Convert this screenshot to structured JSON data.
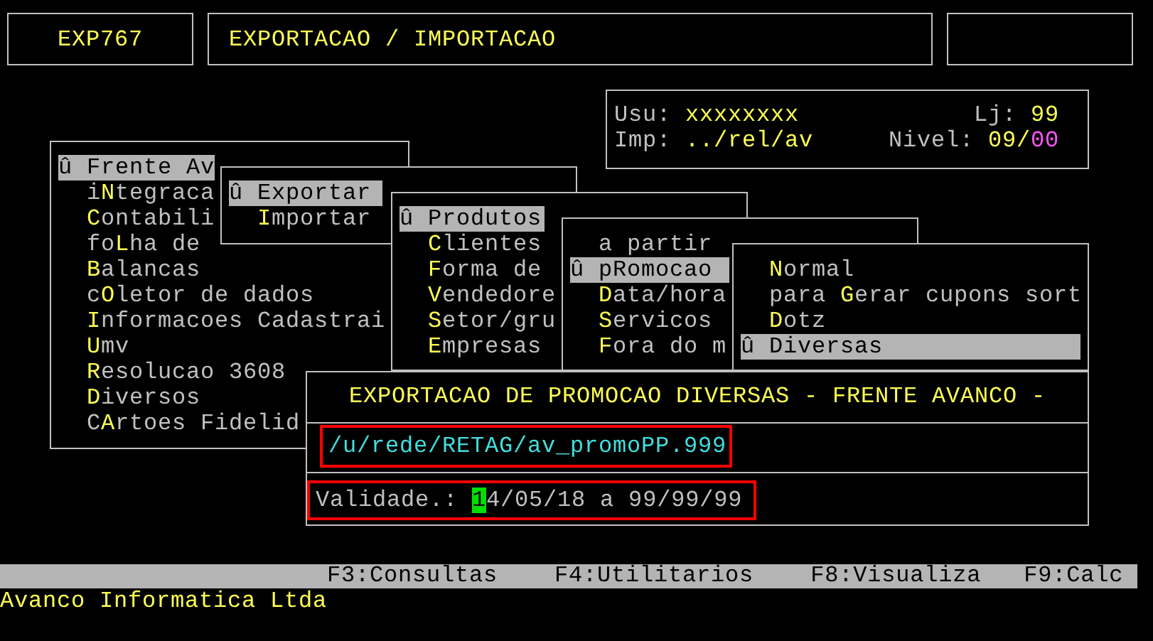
{
  "header": {
    "code": "EXP767",
    "title": "EXPORTACAO / IMPORTACAO"
  },
  "session": {
    "user_label": "Usu:",
    "user": "xxxxxxxx",
    "store_label": "Lj:",
    "store": "99",
    "printer_label": "Imp:",
    "printer": "../rel/av",
    "nivel_label": "Nivel:",
    "nivel_main": "09/",
    "nivel_sub": "00"
  },
  "menus": [
    {
      "marker": "û",
      "items": [
        {
          "key": "F",
          "post": "rente Av",
          "selected": true
        },
        {
          "pre": "i",
          "key": "N",
          "post": "tegraca",
          "selected": false
        },
        {
          "key": "C",
          "post": "ontabili",
          "selected": false
        },
        {
          "pre": "fo",
          "key": "L",
          "post": "ha de",
          "selected": false
        },
        {
          "key": "B",
          "post": "alancas",
          "selected": false
        },
        {
          "pre": "c",
          "key": "O",
          "post": "letor de dados",
          "selected": false
        },
        {
          "key": "I",
          "post": "nformacoes Cadastrai",
          "selected": false
        },
        {
          "key": "U",
          "post": "mv",
          "selected": false
        },
        {
          "key": "R",
          "post": "esolucao 3608",
          "selected": false
        },
        {
          "key": "D",
          "post": "iversos",
          "selected": false
        },
        {
          "pre": "C",
          "key": "A",
          "post": "rtoes Fidelid",
          "selected": false
        }
      ]
    },
    {
      "marker": "û",
      "items": [
        {
          "key": "E",
          "post": "xportar",
          "selected": true
        },
        {
          "key": "I",
          "post": "mportar",
          "selected": false
        }
      ]
    },
    {
      "marker": "û",
      "items": [
        {
          "key": "P",
          "post": "rodutos",
          "selected": true
        },
        {
          "key": "C",
          "post": "lientes",
          "selected": false
        },
        {
          "key": "F",
          "post": "orma de",
          "selected": false
        },
        {
          "key": "V",
          "post": "endedore",
          "selected": false
        },
        {
          "key": "S",
          "post": "etor/gru",
          "selected": false
        },
        {
          "key": "E",
          "post": "mpresas",
          "selected": false
        }
      ]
    },
    {
      "marker": "û",
      "items": [
        {
          "pre": "a partir",
          "selected": false
        },
        {
          "pre": "p",
          "key": "R",
          "post": "omocao",
          "selected": true
        },
        {
          "key": "D",
          "post": "ata/hora",
          "selected": false
        },
        {
          "key": "S",
          "post": "ervicos",
          "selected": false
        },
        {
          "key": "F",
          "post": "ora do m",
          "selected": false
        }
      ]
    },
    {
      "marker": "û",
      "items": [
        {
          "key": "N",
          "post": "ormal",
          "selected": false
        },
        {
          "pre": "para ",
          "key": "G",
          "post": "erar cupons sort",
          "selected": false
        },
        {
          "key": "D",
          "post": "otz",
          "selected": false
        },
        {
          "key": "D",
          "post": "iversas",
          "selected": true
        }
      ]
    }
  ],
  "dialog": {
    "title": "EXPORTACAO DE PROMOCAO DIVERSAS - FRENTE AVANCO -",
    "path": "/u/rede/RETAG/av_promoPP.999",
    "validity_label": "Validade.:",
    "validity_cursor": "1",
    "validity_rest": "4/05/18 a 99/99/99"
  },
  "function_keys": [
    "F3:Consultas",
    "F4:Utilitarios",
    "F8:Visualiza",
    "F9:Calc"
  ],
  "company": "Avanco Informatica Ltda"
}
